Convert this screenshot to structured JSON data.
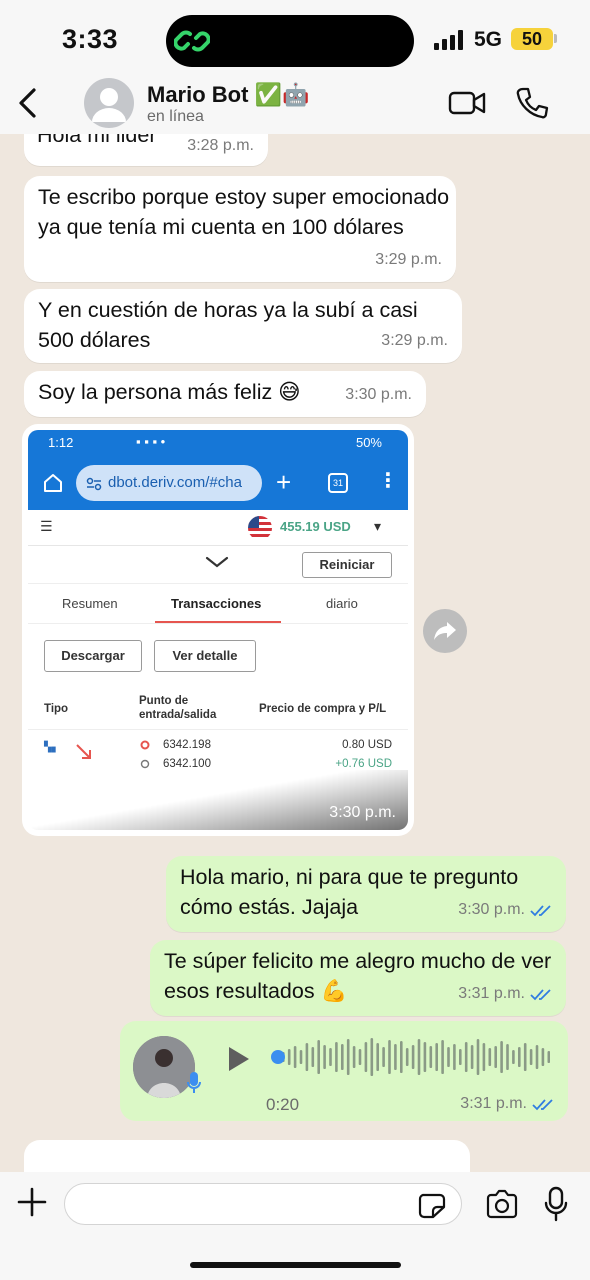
{
  "status_bar": {
    "time": "3:33",
    "network": "5G",
    "battery": "50"
  },
  "header": {
    "contact_name": "Mario Bot",
    "name_emojis": "✅🤖",
    "status": "en línea"
  },
  "messages": [
    {
      "direction": "incoming",
      "text": "Hola mi lider",
      "time": "3:28 p.m."
    },
    {
      "direction": "incoming",
      "text": "Te escribo porque estoy super emocionado ya que tenía mi cuenta en 100 dólares",
      "time": "3:29 p.m."
    },
    {
      "direction": "incoming",
      "text": "Y en cuestión de horas ya la subí a casi 500 dólares",
      "time": "3:29 p.m."
    },
    {
      "direction": "incoming",
      "text": "Soy la persona más feliz 😅",
      "time": "3:30 p.m."
    },
    {
      "direction": "outgoing",
      "text": "Hola mario, ni para que te pregunto cómo estás. Jajaja",
      "time": "3:30 p.m."
    },
    {
      "direction": "outgoing",
      "text": "Te súper felicito me alegro mucho de ver esos resultados 💪",
      "time": "3:31 p.m."
    }
  ],
  "image_message": {
    "time": "3:30 p.m.",
    "screenshot": {
      "status_time": "1:12",
      "status_battery": "50%",
      "url": "dbot.deriv.com/#cha",
      "tab_count": "31",
      "balance": "455.19 USD",
      "reset_button": "Reiniciar",
      "tabs": [
        "Resumen",
        "Transacciones",
        "diario"
      ],
      "download_button": "Descargar",
      "details_button": "Ver detalle",
      "col_type": "Tipo",
      "col_entry": "Punto de entrada/salida",
      "col_price": "Precio de compra y P/L",
      "entry_price": "6342.198",
      "exit_price": "6342.100",
      "buy_price": "0.80 USD",
      "profit": "+0.76 USD"
    }
  },
  "voice_message": {
    "duration": "0:20",
    "time": "3:31 p.m.",
    "status": "read"
  },
  "colors": {
    "incoming_bubble": "#ffffff",
    "outgoing_bubble": "#dbf8c6",
    "read_ticks": "#2f7de1",
    "chat_background": "#efe7de"
  },
  "icons": [
    "back-icon",
    "video-call-icon",
    "phone-icon",
    "share-icon",
    "play-icon",
    "mic-icon",
    "plus-icon",
    "sticker-icon",
    "camera-icon"
  ]
}
